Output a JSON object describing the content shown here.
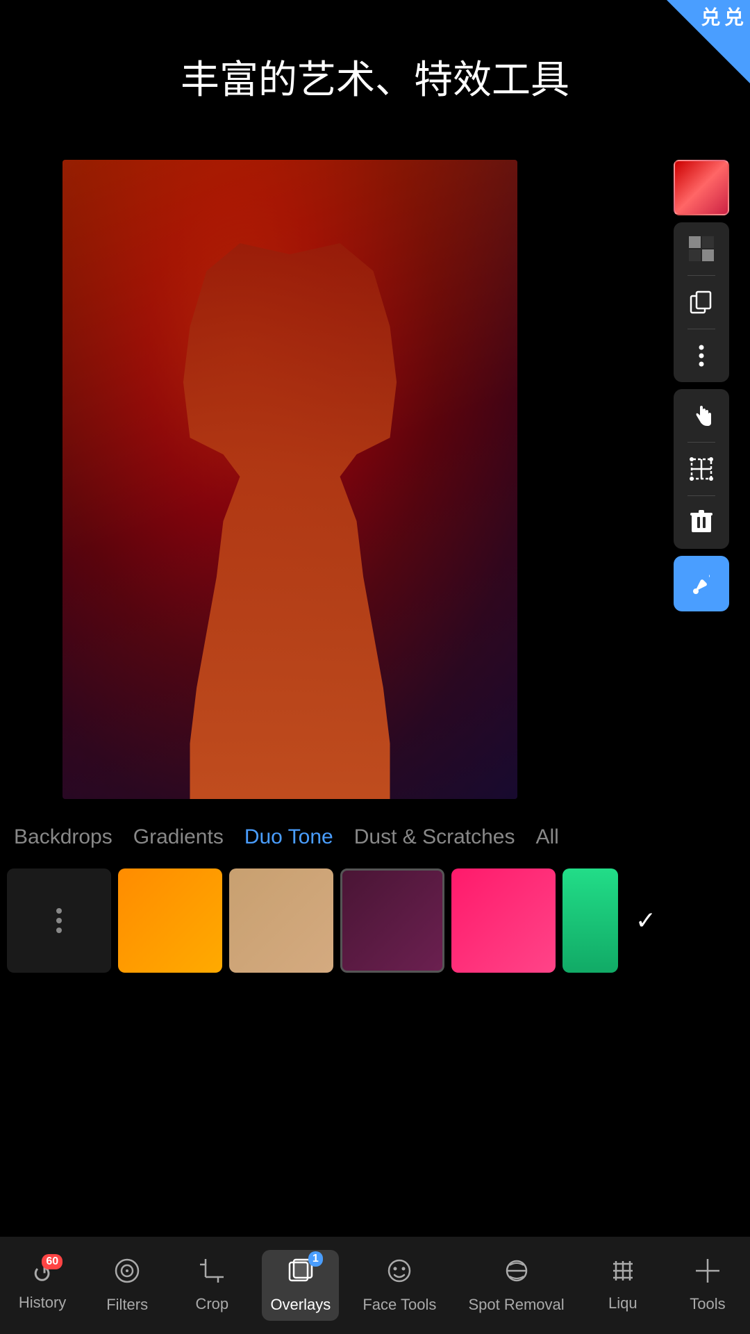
{
  "badge": {
    "text": "兑\n兑"
  },
  "title": "丰富的艺术、特效工具",
  "right_toolbar": {
    "swatch_label": "color swatch",
    "checker_icon": "■",
    "copy_icon": "⧉",
    "more_icon": "⋮",
    "hand_icon": "✋",
    "transform_icon": "⊹",
    "trash_icon": "⌫",
    "eyedropper_icon": "✎"
  },
  "category_tabs": [
    {
      "label": "Backdrops",
      "active": false
    },
    {
      "label": "Gradients",
      "active": false
    },
    {
      "label": "Duo Tone",
      "active": true
    },
    {
      "label": "Dust & Scratches",
      "active": false
    },
    {
      "label": "All",
      "active": false
    }
  ],
  "bottom_nav": [
    {
      "label": "History",
      "badge": "60",
      "badge_type": "plain",
      "active": false,
      "icon": "↺"
    },
    {
      "label": "Filters",
      "badge": null,
      "active": false,
      "icon": "◎"
    },
    {
      "label": "Crop",
      "badge": null,
      "active": false,
      "icon": "⊡"
    },
    {
      "label": "Overlays",
      "badge": "1",
      "badge_type": "blue",
      "active": true,
      "icon": "⊕"
    },
    {
      "label": "Face Tools",
      "badge": null,
      "active": false,
      "icon": "☻"
    },
    {
      "label": "Spot Removal",
      "badge": null,
      "active": false,
      "icon": "✂"
    },
    {
      "label": "Liqu",
      "badge": null,
      "active": false,
      "icon": "#"
    },
    {
      "label": "Tools",
      "badge": null,
      "active": false,
      "icon": "+"
    }
  ]
}
